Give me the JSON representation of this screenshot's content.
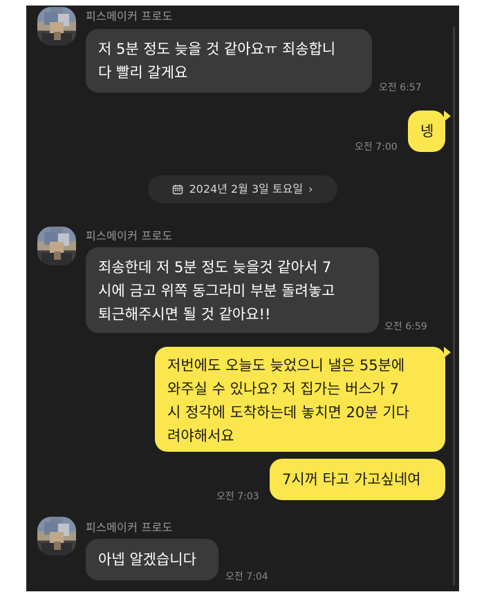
{
  "contact": {
    "name": "피스메이커 프로도"
  },
  "date_divider": {
    "label": "2024년 2월 3일 토요일",
    "chevron": "›"
  },
  "messages": [
    {
      "from": "contact",
      "lines": [
        "저 5분 정도 늦을 것 같아요ㅠ 죄송합니",
        "다 빨리 갈게요"
      ],
      "time": "오전 6:57"
    },
    {
      "from": "me",
      "lines": [
        "넹"
      ],
      "time": "오전 7:00"
    },
    {
      "from": "contact",
      "lines": [
        "죄송한데 저 5분 정도 늦을것 같아서 7",
        "시에 금고 위쪽 동그라미 부분 돌려놓고",
        "퇴근해주시면 될 것 같아요!!"
      ],
      "time": "오전 6:59"
    },
    {
      "from": "me",
      "lines": [
        "저번에도 오늘도 늦었으니 낼은 55분에",
        "와주실 수 있나요? 저 집가는 버스가  7",
        "시 정각에 도착하는데 놓치면 20분 기다",
        "려야해서요"
      ]
    },
    {
      "from": "me",
      "lines": [
        "7시꺼 타고 가고싶네여"
      ],
      "time": "오전 7:03"
    },
    {
      "from": "contact",
      "lines": [
        "아넵 알겠습니다"
      ],
      "time": "오전 7:04"
    }
  ],
  "icons": {
    "calendar": "calendar-icon",
    "chevron": "chevron-right-icon"
  },
  "colors": {
    "background": "#1e1e1e",
    "incoming_bubble": "#3a3a3a",
    "outgoing_bubble": "#fbe64d",
    "text": "#ffffff",
    "meta_text": "#8a8a8a"
  }
}
